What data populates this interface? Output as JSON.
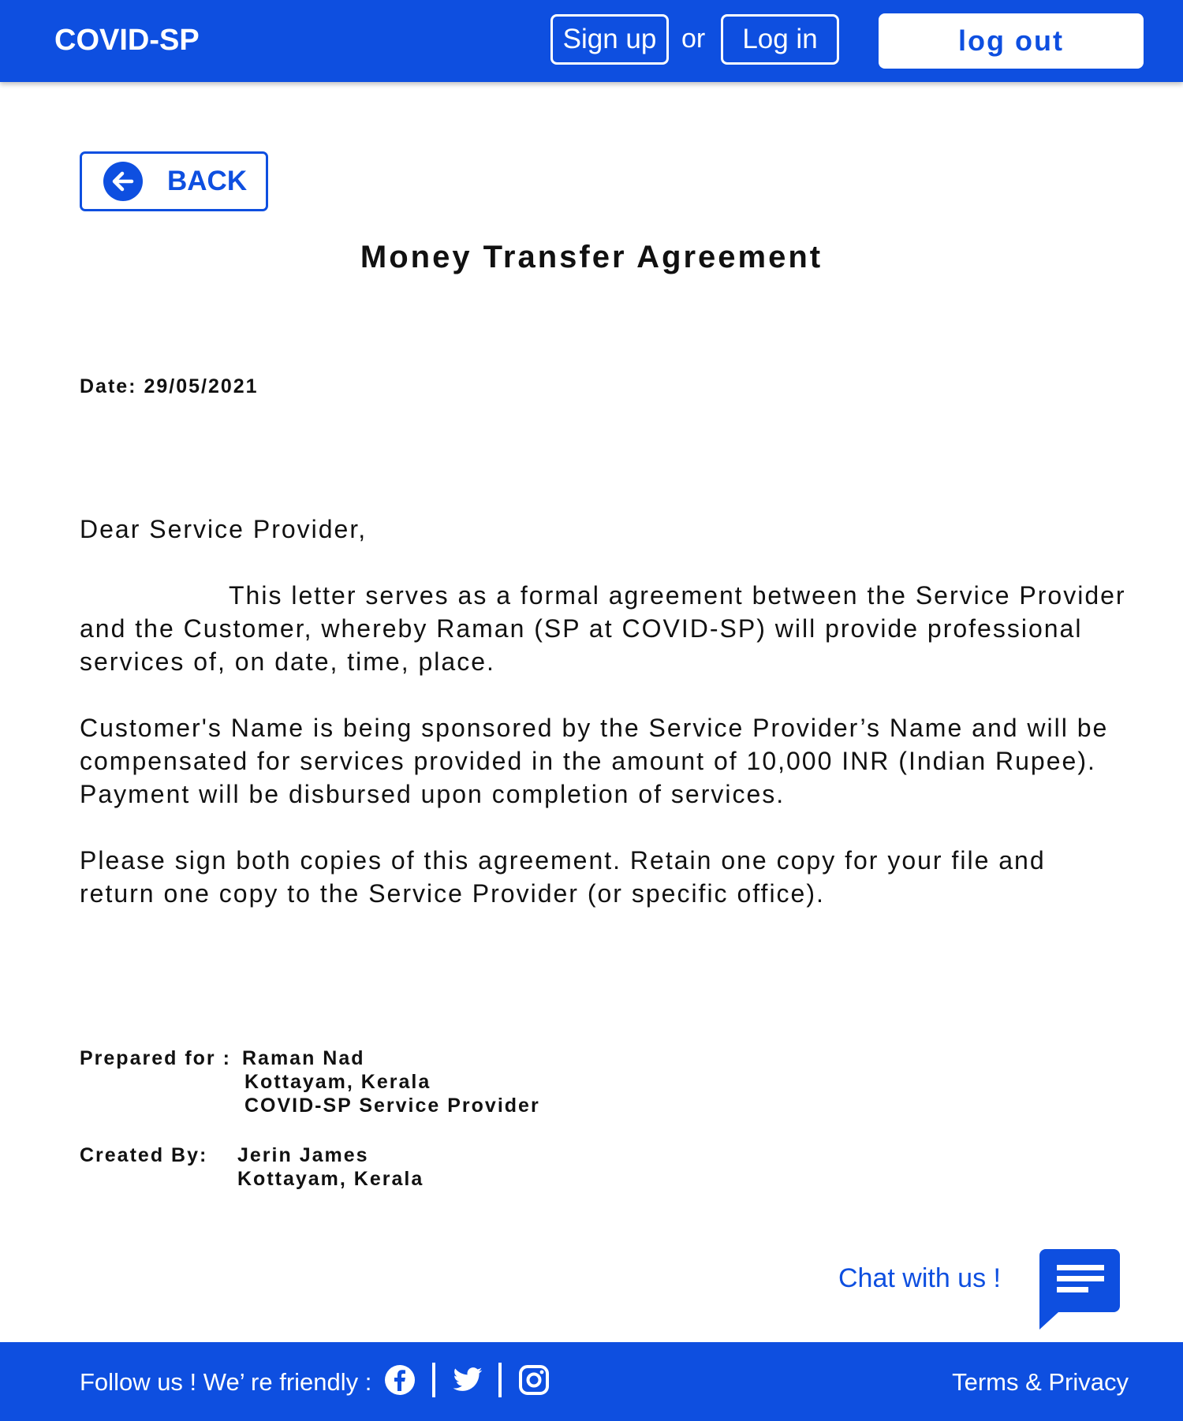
{
  "header": {
    "brand": "COVID-SP",
    "signup_label": "Sign up",
    "or_text": "or",
    "login_label": "Log in",
    "logout_label": "log out"
  },
  "back": {
    "label": "BACK",
    "icon": "arrow-left-circle-icon"
  },
  "title": "Money Transfer Agreement",
  "date": "Date: 29/05/2021",
  "letter": {
    "salutation": "Dear Service Provider,",
    "para1": "This letter serves as a formal agreement between the Service Provider and the Customer, whereby Raman (SP at COVID-SP) will provide professional services of, on date, time, place.",
    "para2": "Customer's Name is being sponsored by the Service Provider’s Name and will be compensated for services provided in the amount of 10,000 INR (Indian Rupee). Payment will be disbursed upon completion of services.",
    "para3": "Please sign both copies of this agreement. Retain one copy for your file and return one copy to the Service Provider (or specific office)."
  },
  "prepared": {
    "label": "Prepared for :",
    "lines": [
      "Raman Nad",
      "Kottayam, Kerala",
      "COVID-SP Service Provider"
    ]
  },
  "created": {
    "label": "Created By:",
    "lines": [
      "Jerin James",
      "Kottayam, Kerala"
    ]
  },
  "chat": {
    "label": "Chat with us !",
    "icon": "chat-bubble-icon"
  },
  "footer": {
    "follow_text": "Follow us !  We’ re friendly :",
    "icons": [
      "facebook-icon",
      "twitter-icon",
      "instagram-icon"
    ],
    "terms_label": "Terms & Privacy"
  },
  "colors": {
    "primary": "#0e4fe0",
    "text": "#111111",
    "background": "#ffffff"
  }
}
